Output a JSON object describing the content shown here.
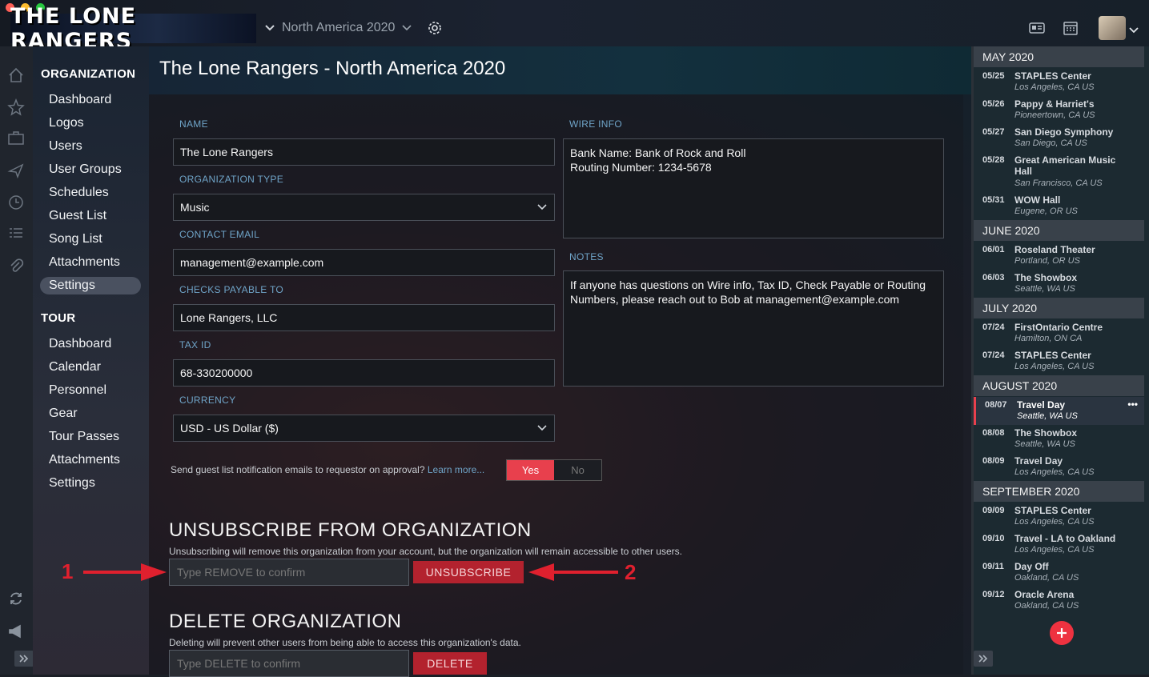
{
  "app": {
    "logo_text": "THE LONE RANGERS",
    "tour_selector": "North America 2020"
  },
  "colors": {
    "accent_red": "#e8404d",
    "link_blue": "#6fa4c8",
    "annotation_red": "#e0202e"
  },
  "sidebar": {
    "org_heading": "ORGANIZATION",
    "org_items": [
      "Dashboard",
      "Logos",
      "Users",
      "User Groups",
      "Schedules",
      "Guest List",
      "Song List",
      "Attachments",
      "Settings"
    ],
    "org_selected": "Settings",
    "tour_heading": "TOUR",
    "tour_items": [
      "Dashboard",
      "Calendar",
      "Personnel",
      "Gear",
      "Tour Passes",
      "Attachments",
      "Settings"
    ]
  },
  "page": {
    "title": "The Lone Rangers - North America 2020"
  },
  "form": {
    "name_label": "NAME",
    "name_value": "The Lone Rangers",
    "orgtype_label": "ORGANIZATION TYPE",
    "orgtype_value": "Music",
    "email_label": "CONTACT EMAIL",
    "email_value": "management@example.com",
    "checks_label": "CHECKS PAYABLE TO",
    "checks_value": "Lone Rangers, LLC",
    "taxid_label": "TAX ID",
    "taxid_value": "68-330200000",
    "currency_label": "CURRENCY",
    "currency_value": "USD - US Dollar ($)",
    "wire_label": "WIRE INFO",
    "wire_value": "Bank Name: Bank of Rock and Roll\nRouting Number: 1234-5678",
    "notes_label": "NOTES",
    "notes_value": "If anyone has questions on Wire info, Tax ID, Check Payable or Routing Numbers, please reach out to Bob at management@example.com",
    "guest_text": "Send guest list notification emails to requestor on approval?",
    "guest_link": "Learn more...",
    "yes": "Yes",
    "no": "No"
  },
  "unsubscribe": {
    "heading": "UNSUBSCRIBE FROM ORGANIZATION",
    "description": "Unsubscribing will remove this organization from your account, but the organization will remain accessible to other users.",
    "placeholder": "Type REMOVE to confirm",
    "button": "UNSUBSCRIBE"
  },
  "delete": {
    "heading": "DELETE ORGANIZATION",
    "description": "Deleting will prevent other users from being able to access this organization's data.",
    "placeholder": "Type DELETE to confirm",
    "button": "DELETE"
  },
  "annotations": {
    "one": "1",
    "two": "2"
  },
  "schedule": [
    {
      "month": "MAY 2020",
      "events": [
        {
          "date": "05/25",
          "title": "STAPLES Center",
          "loc": "Los Angeles, CA US"
        },
        {
          "date": "05/26",
          "title": "Pappy & Harriet's",
          "loc": "Pioneertown, CA US"
        },
        {
          "date": "05/27",
          "title": "San Diego Symphony",
          "loc": "San Diego, CA US"
        },
        {
          "date": "05/28",
          "title": "Great American Music Hall",
          "loc": "San Francisco, CA US"
        },
        {
          "date": "05/31",
          "title": "WOW Hall",
          "loc": "Eugene, OR US"
        }
      ]
    },
    {
      "month": "JUNE 2020",
      "events": [
        {
          "date": "06/01",
          "title": "Roseland Theater",
          "loc": "Portland, OR US"
        },
        {
          "date": "06/03",
          "title": "The Showbox",
          "loc": "Seattle, WA US"
        }
      ]
    },
    {
      "month": "JULY 2020",
      "events": [
        {
          "date": "07/24",
          "title": "FirstOntario Centre",
          "loc": "Hamilton, ON CA"
        },
        {
          "date": "07/24",
          "title": "STAPLES Center",
          "loc": "Los Angeles, CA US"
        }
      ]
    },
    {
      "month": "AUGUST 2020",
      "events": [
        {
          "date": "08/07",
          "title": "Travel Day",
          "loc": "Seattle, WA US",
          "selected": true
        },
        {
          "date": "08/08",
          "title": "The Showbox",
          "loc": "Seattle, WA US"
        },
        {
          "date": "08/09",
          "title": "Travel Day",
          "loc": "Los Angeles, CA US"
        }
      ]
    },
    {
      "month": "SEPTEMBER 2020",
      "events": [
        {
          "date": "09/09",
          "title": "STAPLES Center",
          "loc": "Los Angeles, CA US"
        },
        {
          "date": "09/10",
          "title": "Travel - LA to Oakland",
          "loc": "Los Angeles, CA US"
        },
        {
          "date": "09/11",
          "title": "Day Off",
          "loc": "Oakland, CA US"
        },
        {
          "date": "09/12",
          "title": "Oracle Arena",
          "loc": "Oakland, CA US"
        }
      ]
    }
  ]
}
